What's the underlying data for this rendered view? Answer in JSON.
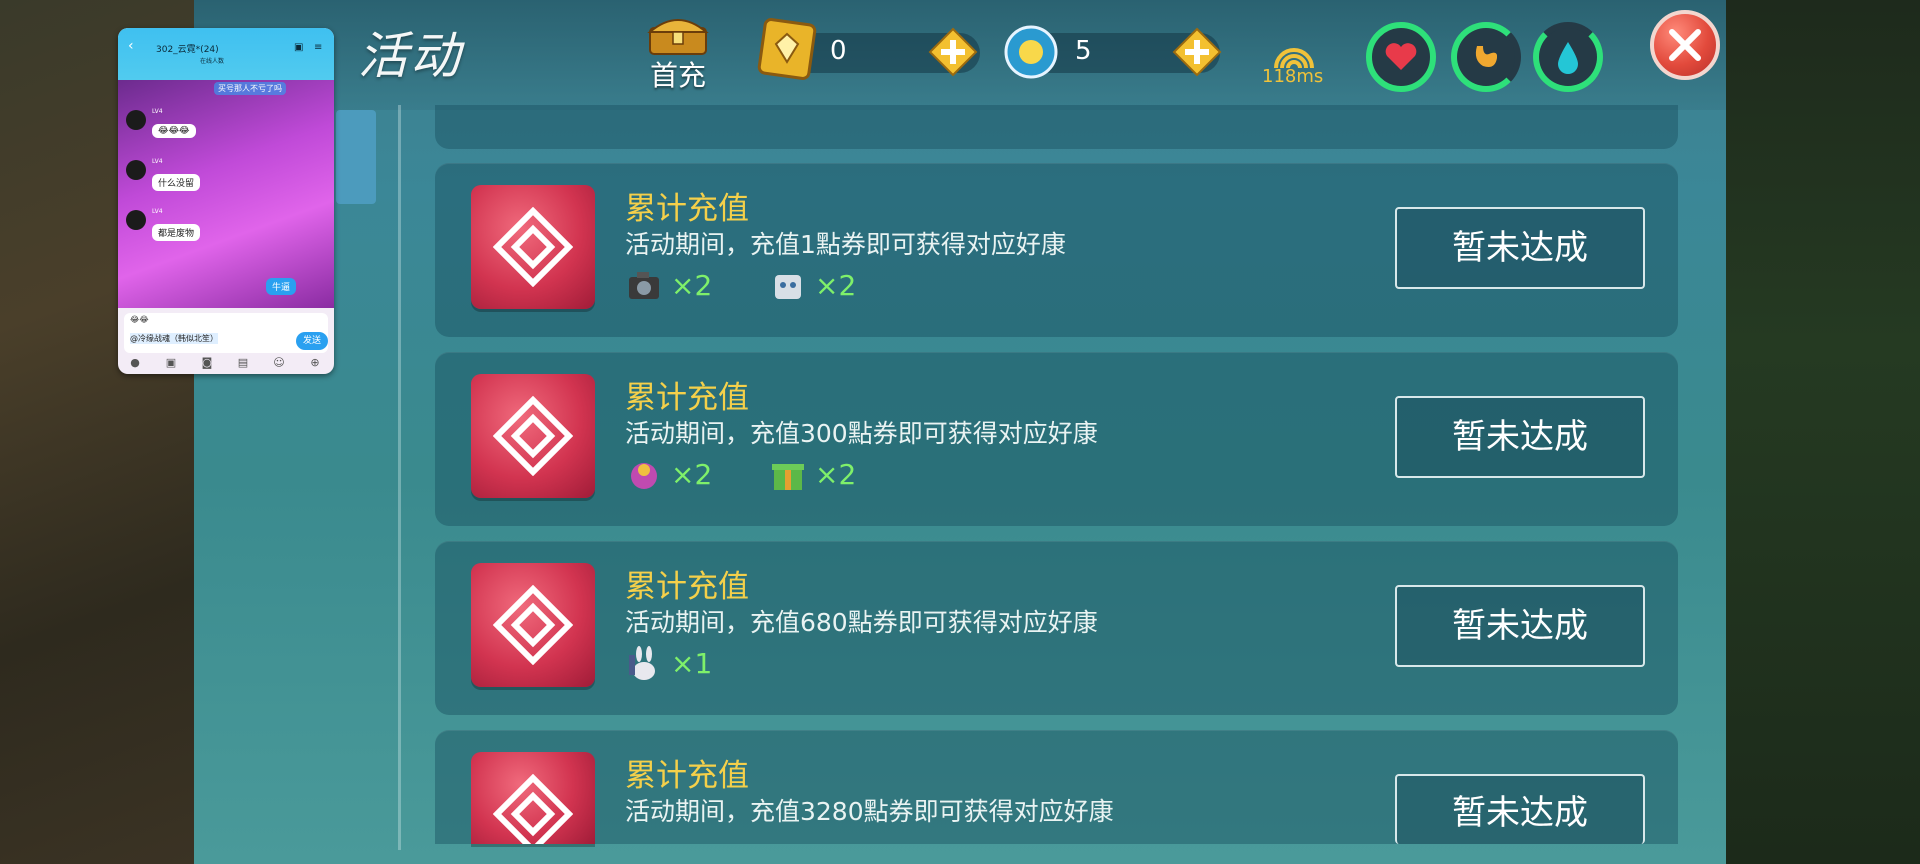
{
  "header": {
    "title": "活动",
    "first_charge_label": "首充",
    "gold_value": "0",
    "star_value": "5",
    "ping": "118ms"
  },
  "colors": {
    "title_yellow": "#f5d04a",
    "reward_green": "#7ff06a",
    "gem_red": "#d23450",
    "close_red": "#e24a3c",
    "panel_teal": "#3b8797"
  },
  "icons": {
    "first_charge": "treasure-chest-icon",
    "gold": "gold-ticket-icon",
    "star": "sun-coin-icon",
    "plus": "plus-diamond-icon",
    "ping": "signal-icon",
    "health": "heart-icon",
    "hunger": "stomach-icon",
    "thirst": "water-drop-icon",
    "close": "close-icon"
  },
  "stats": {
    "health_fill": 1.0,
    "hunger_fill": 0.75,
    "thirst_fill": 0.8
  },
  "cards": [
    {
      "title": "累计充值",
      "desc": "活动期间，充值1點券即可获得对应好康",
      "rewards": [
        {
          "icon": "camera-icon",
          "count": "×2"
        },
        {
          "icon": "robot-icon",
          "count": "×2"
        }
      ],
      "status": "暂未达成"
    },
    {
      "title": "累计充值",
      "desc": "活动期间，充值300點券即可获得对应好康",
      "rewards": [
        {
          "icon": "flower-pot-icon",
          "count": "×2"
        },
        {
          "icon": "gift-box-icon",
          "count": "×2"
        }
      ],
      "status": "暂未达成"
    },
    {
      "title": "累计充值",
      "desc": "活动期间，充值680點券即可获得对应好康",
      "rewards": [
        {
          "icon": "rabbit-figure-icon",
          "count": "×1"
        }
      ],
      "status": "暂未达成"
    },
    {
      "title": "累计充值",
      "desc": "活动期间，充值3280點券即可获得对应好康",
      "rewards": [],
      "status": "暂未达成"
    }
  ],
  "chat": {
    "group_name": "302_云霓*(24)",
    "subtitle": "在线人数",
    "banner": "买号那人不亏了吗",
    "messages": [
      {
        "text": "😂😂😂"
      },
      {
        "text": "什么没留"
      },
      {
        "text": "都是废物"
      }
    ],
    "my_message": "牛逼",
    "input_quote": "😂😂",
    "input_text": "@冷缘战魂（韩似北笙）",
    "send_label": "发送"
  }
}
